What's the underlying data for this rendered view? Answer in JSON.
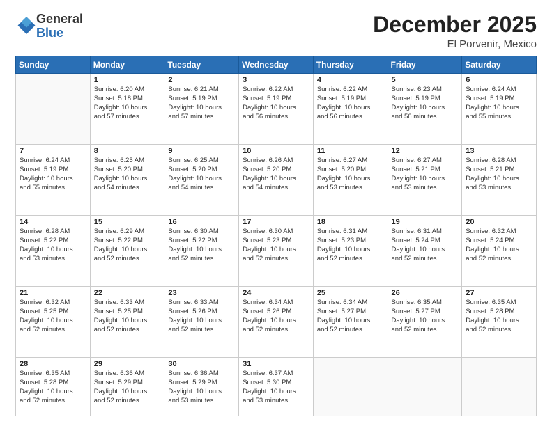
{
  "header": {
    "logo_general": "General",
    "logo_blue": "Blue",
    "month": "December 2025",
    "location": "El Porvenir, Mexico"
  },
  "days_of_week": [
    "Sunday",
    "Monday",
    "Tuesday",
    "Wednesday",
    "Thursday",
    "Friday",
    "Saturday"
  ],
  "weeks": [
    [
      {
        "day": "",
        "content": ""
      },
      {
        "day": "1",
        "content": "Sunrise: 6:20 AM\nSunset: 5:18 PM\nDaylight: 10 hours\nand 57 minutes."
      },
      {
        "day": "2",
        "content": "Sunrise: 6:21 AM\nSunset: 5:19 PM\nDaylight: 10 hours\nand 57 minutes."
      },
      {
        "day": "3",
        "content": "Sunrise: 6:22 AM\nSunset: 5:19 PM\nDaylight: 10 hours\nand 56 minutes."
      },
      {
        "day": "4",
        "content": "Sunrise: 6:22 AM\nSunset: 5:19 PM\nDaylight: 10 hours\nand 56 minutes."
      },
      {
        "day": "5",
        "content": "Sunrise: 6:23 AM\nSunset: 5:19 PM\nDaylight: 10 hours\nand 56 minutes."
      },
      {
        "day": "6",
        "content": "Sunrise: 6:24 AM\nSunset: 5:19 PM\nDaylight: 10 hours\nand 55 minutes."
      }
    ],
    [
      {
        "day": "7",
        "content": "Sunrise: 6:24 AM\nSunset: 5:19 PM\nDaylight: 10 hours\nand 55 minutes."
      },
      {
        "day": "8",
        "content": "Sunrise: 6:25 AM\nSunset: 5:20 PM\nDaylight: 10 hours\nand 54 minutes."
      },
      {
        "day": "9",
        "content": "Sunrise: 6:25 AM\nSunset: 5:20 PM\nDaylight: 10 hours\nand 54 minutes."
      },
      {
        "day": "10",
        "content": "Sunrise: 6:26 AM\nSunset: 5:20 PM\nDaylight: 10 hours\nand 54 minutes."
      },
      {
        "day": "11",
        "content": "Sunrise: 6:27 AM\nSunset: 5:20 PM\nDaylight: 10 hours\nand 53 minutes."
      },
      {
        "day": "12",
        "content": "Sunrise: 6:27 AM\nSunset: 5:21 PM\nDaylight: 10 hours\nand 53 minutes."
      },
      {
        "day": "13",
        "content": "Sunrise: 6:28 AM\nSunset: 5:21 PM\nDaylight: 10 hours\nand 53 minutes."
      }
    ],
    [
      {
        "day": "14",
        "content": "Sunrise: 6:28 AM\nSunset: 5:22 PM\nDaylight: 10 hours\nand 53 minutes."
      },
      {
        "day": "15",
        "content": "Sunrise: 6:29 AM\nSunset: 5:22 PM\nDaylight: 10 hours\nand 52 minutes."
      },
      {
        "day": "16",
        "content": "Sunrise: 6:30 AM\nSunset: 5:22 PM\nDaylight: 10 hours\nand 52 minutes."
      },
      {
        "day": "17",
        "content": "Sunrise: 6:30 AM\nSunset: 5:23 PM\nDaylight: 10 hours\nand 52 minutes."
      },
      {
        "day": "18",
        "content": "Sunrise: 6:31 AM\nSunset: 5:23 PM\nDaylight: 10 hours\nand 52 minutes."
      },
      {
        "day": "19",
        "content": "Sunrise: 6:31 AM\nSunset: 5:24 PM\nDaylight: 10 hours\nand 52 minutes."
      },
      {
        "day": "20",
        "content": "Sunrise: 6:32 AM\nSunset: 5:24 PM\nDaylight: 10 hours\nand 52 minutes."
      }
    ],
    [
      {
        "day": "21",
        "content": "Sunrise: 6:32 AM\nSunset: 5:25 PM\nDaylight: 10 hours\nand 52 minutes."
      },
      {
        "day": "22",
        "content": "Sunrise: 6:33 AM\nSunset: 5:25 PM\nDaylight: 10 hours\nand 52 minutes."
      },
      {
        "day": "23",
        "content": "Sunrise: 6:33 AM\nSunset: 5:26 PM\nDaylight: 10 hours\nand 52 minutes."
      },
      {
        "day": "24",
        "content": "Sunrise: 6:34 AM\nSunset: 5:26 PM\nDaylight: 10 hours\nand 52 minutes."
      },
      {
        "day": "25",
        "content": "Sunrise: 6:34 AM\nSunset: 5:27 PM\nDaylight: 10 hours\nand 52 minutes."
      },
      {
        "day": "26",
        "content": "Sunrise: 6:35 AM\nSunset: 5:27 PM\nDaylight: 10 hours\nand 52 minutes."
      },
      {
        "day": "27",
        "content": "Sunrise: 6:35 AM\nSunset: 5:28 PM\nDaylight: 10 hours\nand 52 minutes."
      }
    ],
    [
      {
        "day": "28",
        "content": "Sunrise: 6:35 AM\nSunset: 5:28 PM\nDaylight: 10 hours\nand 52 minutes."
      },
      {
        "day": "29",
        "content": "Sunrise: 6:36 AM\nSunset: 5:29 PM\nDaylight: 10 hours\nand 52 minutes."
      },
      {
        "day": "30",
        "content": "Sunrise: 6:36 AM\nSunset: 5:29 PM\nDaylight: 10 hours\nand 53 minutes."
      },
      {
        "day": "31",
        "content": "Sunrise: 6:37 AM\nSunset: 5:30 PM\nDaylight: 10 hours\nand 53 minutes."
      },
      {
        "day": "",
        "content": ""
      },
      {
        "day": "",
        "content": ""
      },
      {
        "day": "",
        "content": ""
      }
    ]
  ]
}
